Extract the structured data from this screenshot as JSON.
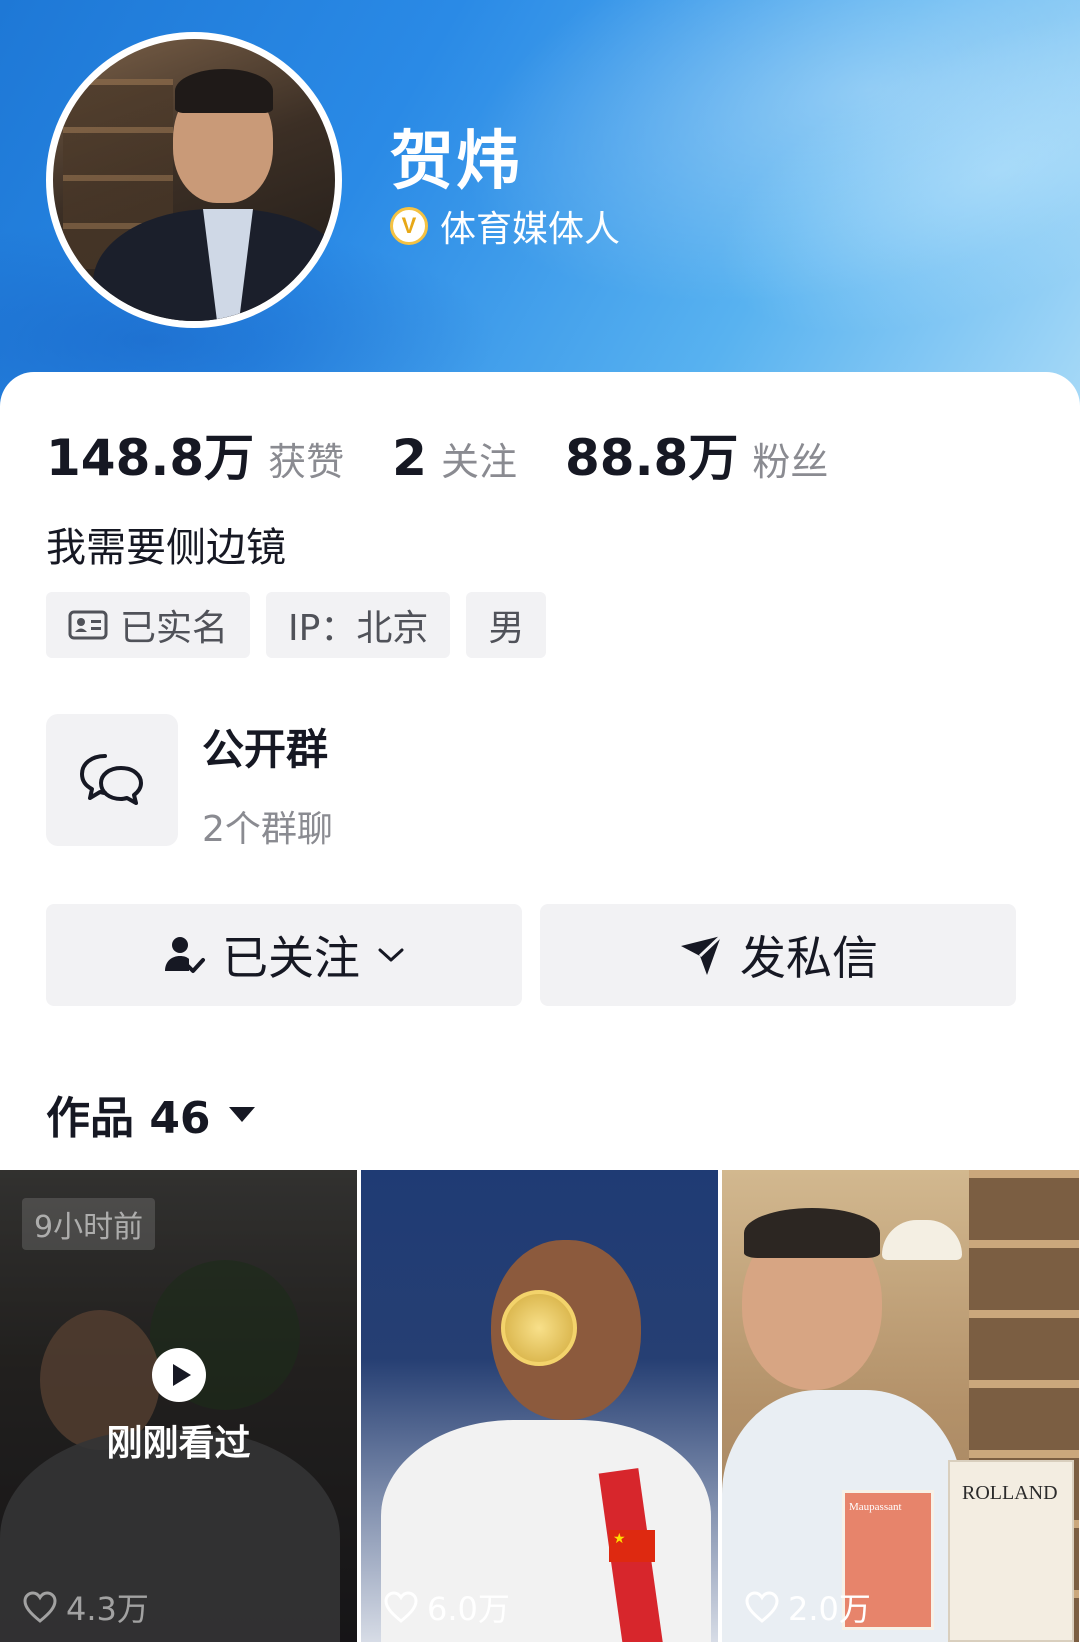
{
  "profile": {
    "name": "贺炜",
    "verify_badge": "V",
    "verify_text": "体育媒体人",
    "bio": "我需要侧边镜"
  },
  "stats": [
    {
      "num": "148.8万",
      "label": "获赞"
    },
    {
      "num": "2",
      "label": "关注"
    },
    {
      "num": "88.8万",
      "label": "粉丝"
    }
  ],
  "tags": {
    "realname": "已实名",
    "ip": "IP：北京",
    "gender": "男"
  },
  "group": {
    "title": "公开群",
    "subtitle": "2个群聊"
  },
  "actions": {
    "follow_label": "已关注",
    "message_label": "发私信"
  },
  "works": {
    "title": "作品 46"
  },
  "videos": [
    {
      "time_badge": "9小时前",
      "watched_label": "刚刚看过",
      "likes": "4.3万"
    },
    {
      "likes": "6.0万"
    },
    {
      "likes": "2.0万",
      "book1_text": "Maupassant",
      "book2_text": "ROLLAND"
    }
  ],
  "colors": {
    "header_gradient_start": "#1e78d6",
    "header_gradient_end": "#a6d9f7",
    "verify_gold": "#e7a817",
    "text_primary": "#161823",
    "text_secondary": "#8a8b91",
    "button_bg": "#f2f2f4"
  }
}
